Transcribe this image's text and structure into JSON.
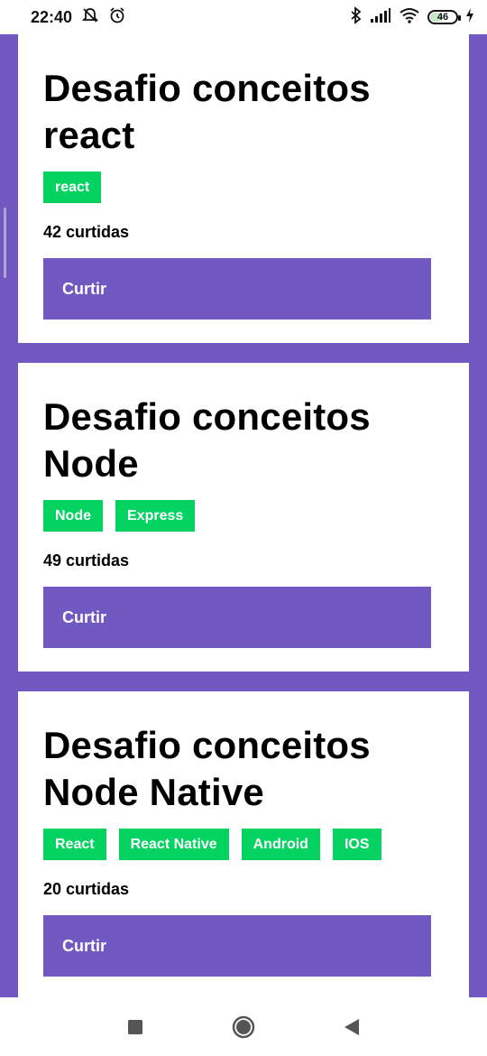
{
  "status_bar": {
    "time": "22:40",
    "battery": "46",
    "left_icons": [
      "alarm-off-icon",
      "alarm-icon"
    ],
    "right_icons": [
      "bluetooth-icon",
      "signal-icon",
      "wifi-icon",
      "battery-icon",
      "charging-icon"
    ]
  },
  "repositories": [
    {
      "title": "Desafio conceitos react",
      "techs": [
        "react"
      ],
      "likes": "42 curtidas",
      "button_label": "Curtir"
    },
    {
      "title": "Desafio conceitos Node",
      "techs": [
        "Node",
        "Express"
      ],
      "likes": "49 curtidas",
      "button_label": "Curtir"
    },
    {
      "title": "Desafio conceitos Node Native",
      "techs": [
        "React",
        "React Native",
        "Android",
        "IOS"
      ],
      "likes": "20 curtidas",
      "button_label": "Curtir"
    }
  ],
  "nav_bar": {
    "buttons": [
      "recents-square-icon",
      "home-circle-icon",
      "back-triangle-icon"
    ]
  },
  "colors": {
    "primary": "#7159c1",
    "tech_badge": "#04d361",
    "card": "#ffffff"
  }
}
